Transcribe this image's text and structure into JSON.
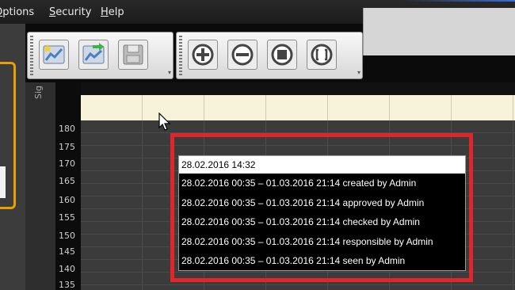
{
  "menu": {
    "items": [
      {
        "label": "Options"
      },
      {
        "label": "Security"
      },
      {
        "label": "Help"
      }
    ]
  },
  "toolbar": {
    "buttons": [
      {
        "icon": "new-sparkle-chart-icon"
      },
      {
        "icon": "open-arrow-chart-icon"
      },
      {
        "icon": "save-disk-icon"
      },
      {
        "icon": "zoom-in-icon"
      },
      {
        "icon": "zoom-out-icon"
      },
      {
        "icon": "fit-square-icon"
      },
      {
        "icon": "fit-brackets-icon"
      }
    ]
  },
  "signal_panel": {
    "label": "Sig"
  },
  "scale": {
    "ticks": [
      "180",
      "175",
      "170",
      "165",
      "160",
      "155",
      "150",
      "145",
      "140",
      "135"
    ]
  },
  "tooltip": {
    "header": "28.02.2016 14:32",
    "rows": [
      {
        "text": "28.02.2016 00:35 – 01.03.2016 21:14 created by Admin"
      },
      {
        "text": "28.02.2016 00:35 – 01.03.2016 21:14 approved by Admin"
      },
      {
        "text": "28.02.2016 00:35 – 01.03.2016 21:14 checked by Admin"
      },
      {
        "text": "28.02.2016 00:35 – 01.03.2016 21:14 responsible by Admin"
      },
      {
        "text": "28.02.2016 00:35 – 01.03.2016 21:14 seen by Admin"
      }
    ]
  },
  "colors": {
    "highlight_frame": "#e0262a",
    "accent_orange": "#e8a000",
    "time_band": "#f6f3da"
  }
}
